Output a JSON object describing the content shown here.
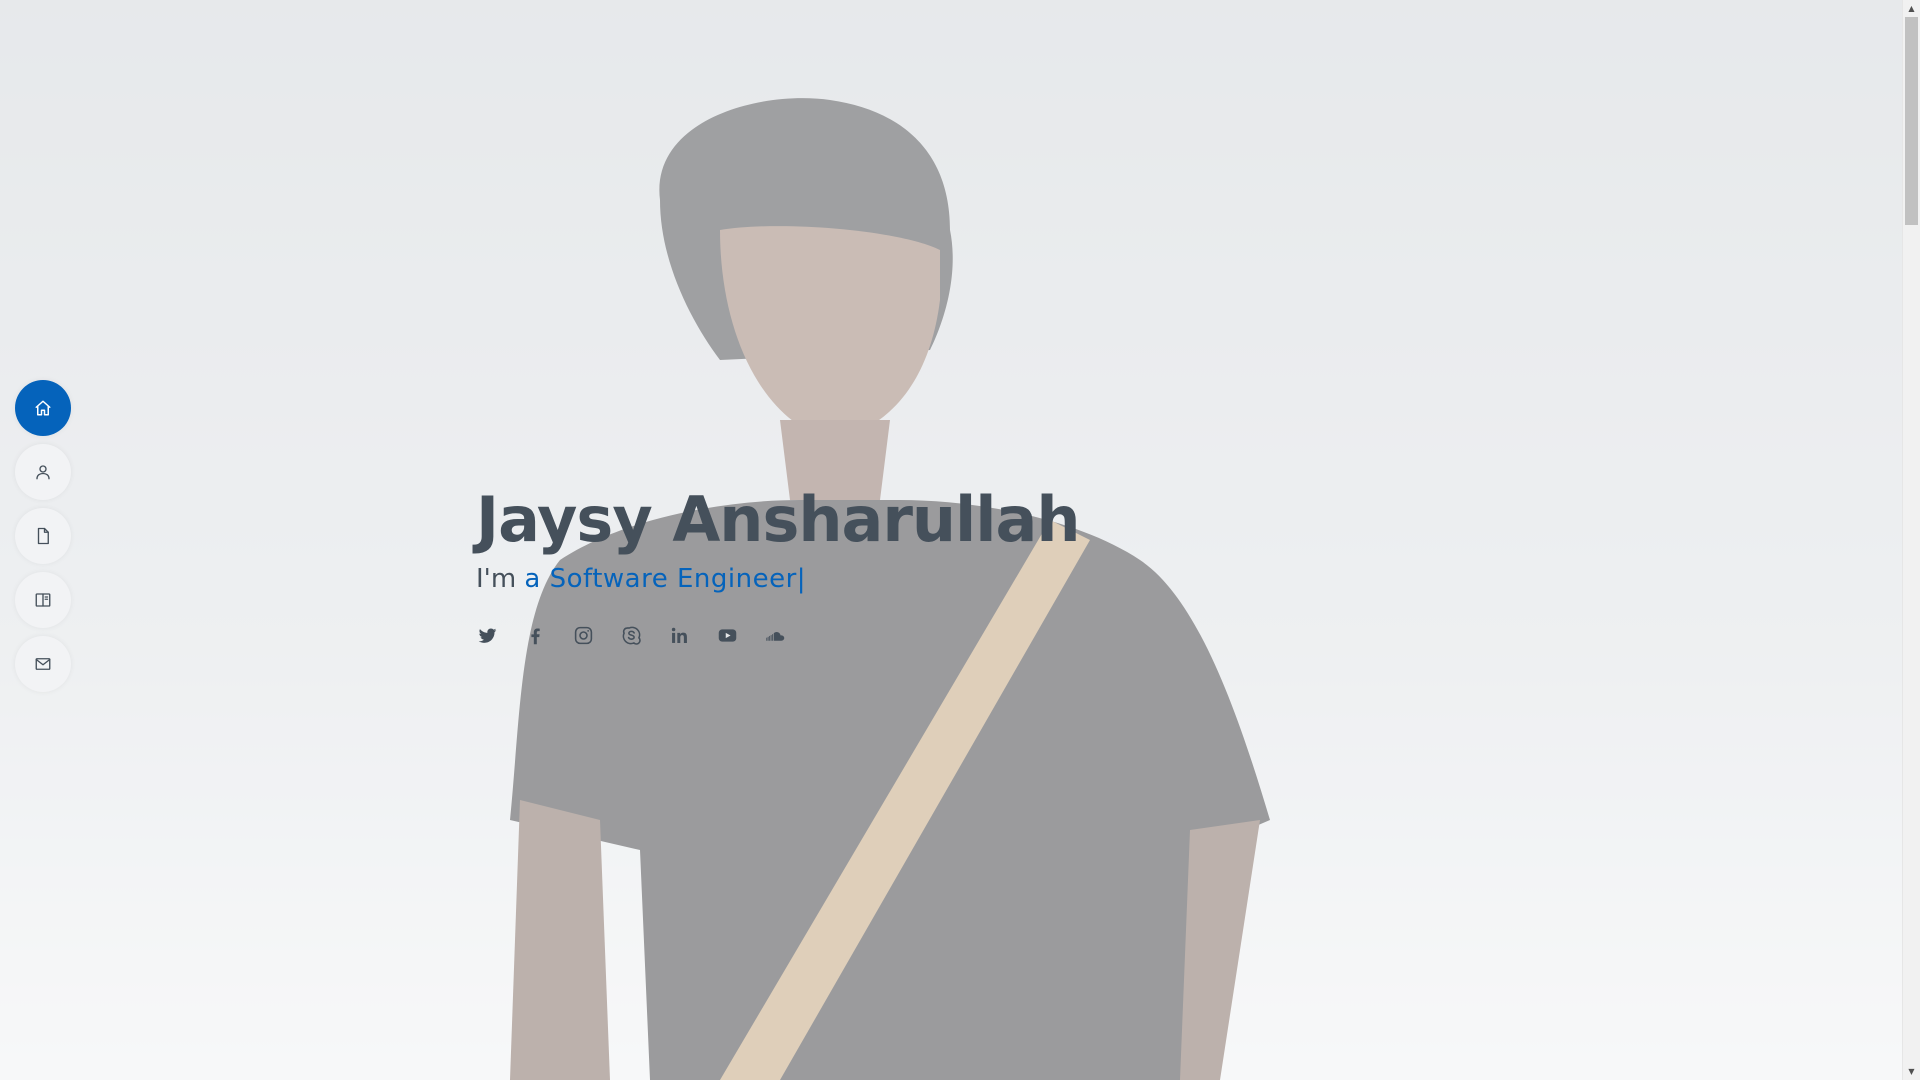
{
  "hero": {
    "name": "Jaysy Ansharullah",
    "intro": "I'm",
    "typed_text": "a Software Engineer",
    "cursor": "|"
  },
  "nav": {
    "items": [
      {
        "icon": "home-icon",
        "active": true
      },
      {
        "icon": "user-icon",
        "active": false
      },
      {
        "icon": "file-icon",
        "active": false
      },
      {
        "icon": "book-icon",
        "active": false
      },
      {
        "icon": "envelope-icon",
        "active": false
      }
    ]
  },
  "social": [
    "twitter-icon",
    "facebook-icon",
    "instagram-icon",
    "skype-icon",
    "linkedin-icon",
    "youtube-icon",
    "soundcloud-icon"
  ],
  "scrollbar": {
    "up": "▲",
    "down": "▼"
  },
  "colors": {
    "accent": "#0563bb",
    "text": "#45505b",
    "background": "#e4e6e8"
  }
}
